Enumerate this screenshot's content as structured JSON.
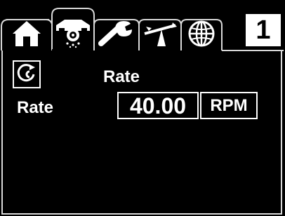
{
  "header": {
    "page_number": "1",
    "tabs": [
      {
        "icon": "home-icon",
        "active": false
      },
      {
        "icon": "spreader-icon",
        "active": true
      },
      {
        "icon": "wrench-icon",
        "active": false
      },
      {
        "icon": "balance-icon",
        "active": false
      },
      {
        "icon": "globe-icon",
        "active": false
      }
    ]
  },
  "main": {
    "icon": "rate-gauge-icon",
    "rate_label": "Rate",
    "field_label": "Rate",
    "value": "40.00",
    "unit": "RPM"
  },
  "colors": {
    "background": "#000000",
    "foreground": "#ffffff",
    "tab_border": "#d9d9d9"
  }
}
